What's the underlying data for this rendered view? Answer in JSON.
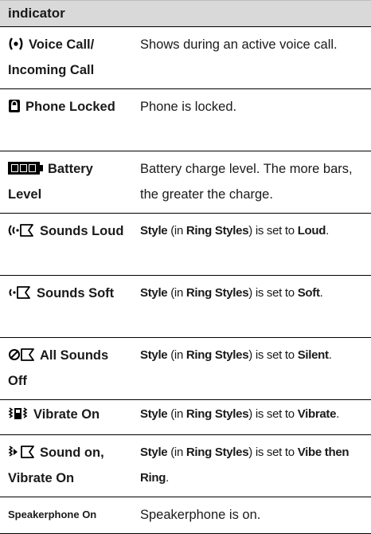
{
  "header": {
    "title": "indicator"
  },
  "rows": [
    {
      "icon": "voice-call-icon",
      "name": "Voice Call/ Incoming Call",
      "desc_plain": "Shows during an active voice call."
    },
    {
      "icon": "lock-icon",
      "name": "Phone Locked",
      "desc_plain": "Phone is locked."
    },
    {
      "icon": "battery-icon",
      "name": "Battery Level",
      "desc_plain": "Battery charge level. The more bars, the greater the charge."
    },
    {
      "icon": "sounds-loud-icon",
      "name": "Sounds Loud",
      "desc": {
        "style": "Style",
        "in": " (in ",
        "ring": "Ring Styles",
        "is": ") is set to ",
        "value": "Loud",
        "end": "."
      }
    },
    {
      "icon": "sounds-soft-icon",
      "name": "Sounds Soft",
      "desc": {
        "style": "Style",
        "in": " (in ",
        "ring": "Ring Styles",
        "is": ") is set to ",
        "value": "Soft",
        "end": "."
      }
    },
    {
      "icon": "sounds-off-icon",
      "name": "All Sounds Off",
      "desc": {
        "style": "Style",
        "in": " (in ",
        "ring": "Ring Styles",
        "is": ") is set to ",
        "value": "Silent",
        "end": "."
      }
    },
    {
      "icon": "vibrate-icon",
      "name": "Vibrate On",
      "desc": {
        "style": "Style",
        "in": " (in ",
        "ring": "Ring Styles",
        "is": ") is set to ",
        "value": "Vibrate",
        "end": "."
      }
    },
    {
      "icon": "vibrate-sound-icon",
      "name": "Sound on, Vibrate On",
      "desc": {
        "style": "Style",
        "in": " (in ",
        "ring": "Ring Styles",
        "is": ") is set to ",
        "value": "Vibe then Ring",
        "end": "."
      }
    },
    {
      "icon": "",
      "name": "Speakerphone On",
      "desc_plain": "Speakerphone is on."
    }
  ]
}
